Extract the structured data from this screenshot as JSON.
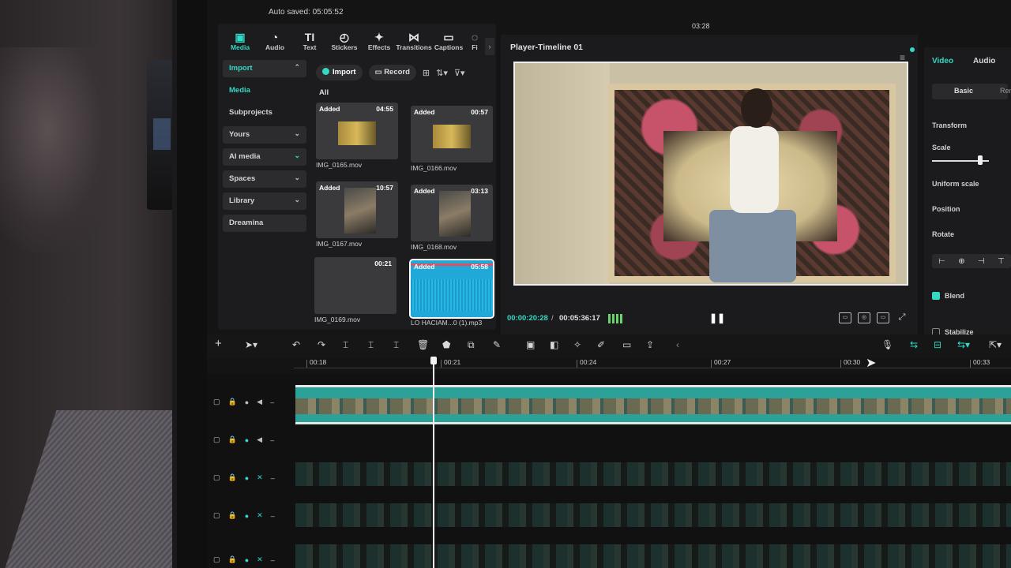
{
  "app": {
    "autosave": "Auto saved: 05:05:52",
    "top_time": "03:28"
  },
  "media_tabs": [
    {
      "label": "Media",
      "icon": "media-icon"
    },
    {
      "label": "Audio",
      "icon": "audio-icon"
    },
    {
      "label": "Text",
      "icon": "text-icon"
    },
    {
      "label": "Stickers",
      "icon": "stickers-icon"
    },
    {
      "label": "Effects",
      "icon": "effects-icon"
    },
    {
      "label": "Transitions",
      "icon": "transitions-icon"
    },
    {
      "label": "Captions",
      "icon": "captions-icon"
    },
    {
      "label": "Fi",
      "icon": "filters-icon"
    }
  ],
  "sidebar": {
    "import": "Import",
    "media": "Media",
    "subprojects": "Subprojects",
    "yours": "Yours",
    "ai_media": "AI media",
    "spaces": "Spaces",
    "library": "Library",
    "dreamina": "Dreamina"
  },
  "media_toolbar": {
    "import": "Import",
    "record": "Record",
    "filter": "All"
  },
  "clips": [
    {
      "badge": "Added",
      "duration": "04:55",
      "name": "IMG_0165.mov"
    },
    {
      "badge": "Added",
      "duration": "00:57",
      "name": "IMG_0166.mov"
    },
    {
      "badge": "Added",
      "duration": "10:57",
      "name": "IMG_0167.mov"
    },
    {
      "badge": "Added",
      "duration": "03:13",
      "name": "IMG_0168.mov"
    },
    {
      "badge": "",
      "duration": "00:21",
      "name": "IMG_0169.mov"
    },
    {
      "badge": "Added",
      "duration": "05:58",
      "name": "LO HACIAM...0 (1).mp3"
    }
  ],
  "player": {
    "title": "Player-Timeline 01",
    "current_time": "00:00:20:28",
    "separator": "/",
    "total_time": "00:05:36:17"
  },
  "properties": {
    "tab_video": "Video",
    "tab_audio": "Audio",
    "sub_basic": "Basic",
    "sub_more": "Rem",
    "transform": "Transform",
    "scale": "Scale",
    "scale_level": 0.85,
    "uniform_scale": "Uniform scale",
    "position": "Position",
    "rotate": "Rotate",
    "blend": "Blend",
    "stabilize": "Stabilize"
  },
  "ruler": {
    "labels": [
      "00:18",
      "00:21",
      "00:24",
      "00:27",
      "00:30",
      "00:33"
    ]
  },
  "colors": {
    "accent": "#33d9c4",
    "clip": "#2ba198"
  }
}
